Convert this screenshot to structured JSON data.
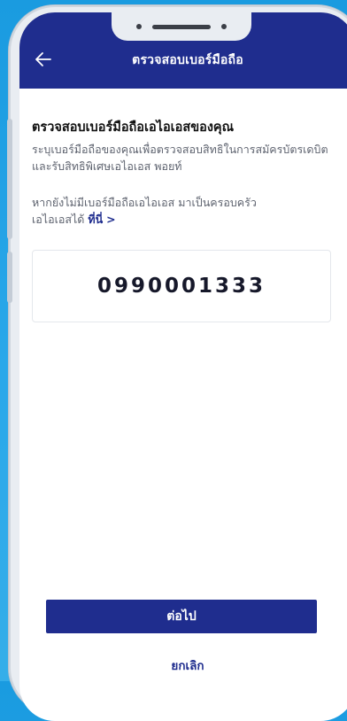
{
  "header": {
    "title": "ตรวจสอบเบอร์มือถือ",
    "back_icon": "arrow-left-icon"
  },
  "content": {
    "heading": "ตรวจสอบเบอร์มือถือเอไอเอสของคุณ",
    "description_line1": "ระบุเบอร์มือถือของคุณเพื่อตรวจสอบสิทธิในการสมัครบัตรเดบิต",
    "description_line2": "และรับสิทธิพิเศษเอไอเอส พอยท์",
    "helper_line1": "หากยังไม่มีเบอร์มือถือเอไอเอส มาเป็นครอบครัว",
    "helper_line2_prefix": "เอไอเอสได้ ",
    "helper_link": "ที่นี่",
    "helper_chevron": ">"
  },
  "phone": {
    "number": "0990001333"
  },
  "actions": {
    "next_label": "ต่อไป",
    "cancel_label": "ยกเลิก"
  },
  "colors": {
    "brand": "#1f2d8e",
    "background": "#2aa8ea"
  }
}
